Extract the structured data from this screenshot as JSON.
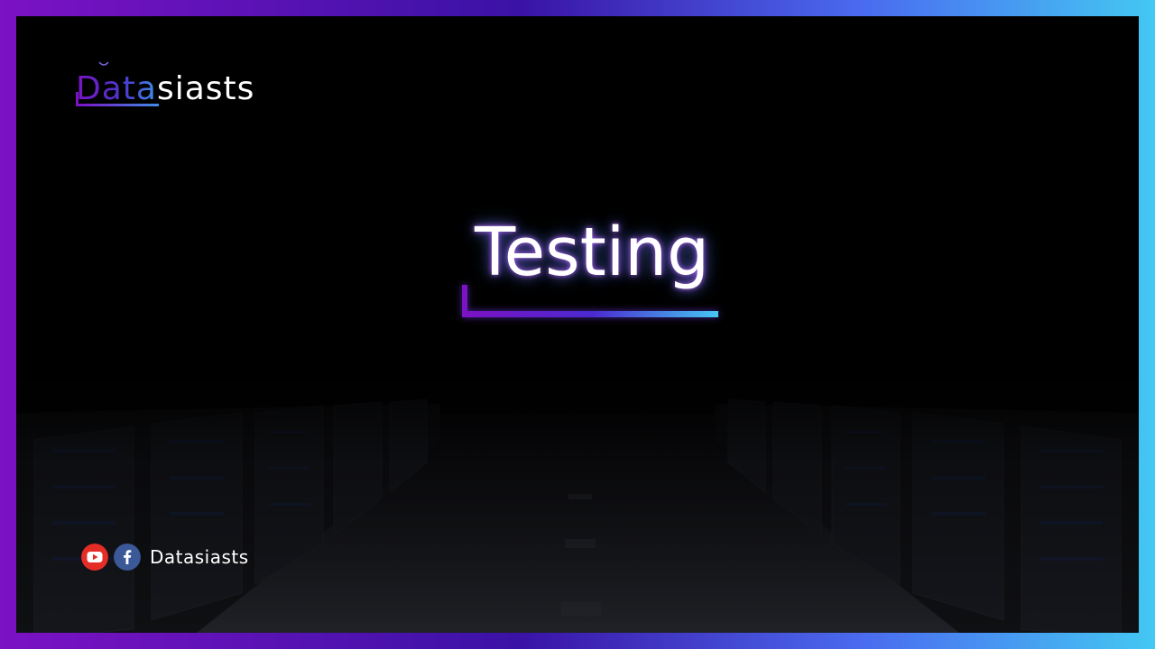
{
  "logo": {
    "accent_text": "Data",
    "rest_text": "siasts"
  },
  "title": {
    "text": "Testing"
  },
  "social": {
    "label": "Datasiasts",
    "icons": [
      "youtube-icon",
      "facebook-icon"
    ]
  },
  "colors": {
    "gradient_start": "#7b12c4",
    "gradient_mid": "#3a12a6",
    "gradient_end": "#44c8f2",
    "background": "#000000",
    "youtube_red": "#e52d27",
    "facebook_blue": "#3b5998"
  }
}
